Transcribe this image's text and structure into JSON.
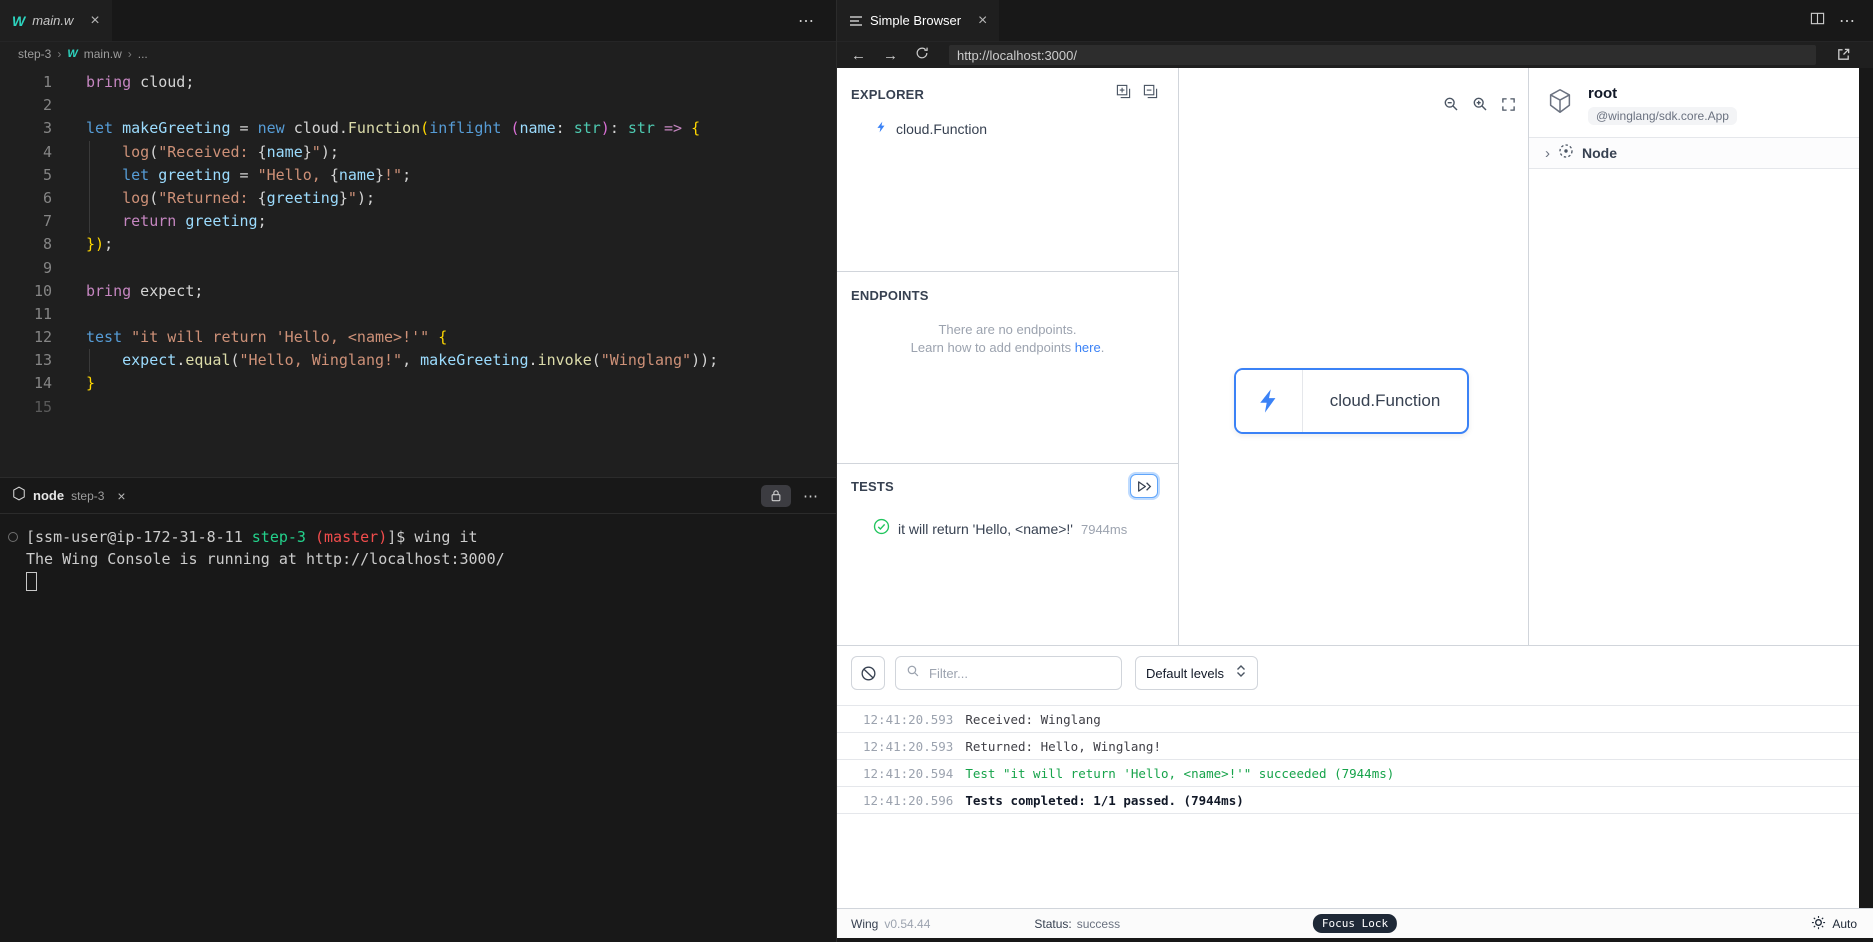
{
  "colors": {
    "accent": "#3b82f6",
    "wing_teal": "#2dd4bf",
    "success_green": "#16a34a",
    "terminal_green": "#23d18b",
    "terminal_red": "#f14c4c"
  },
  "editor": {
    "tab_label": "main.w",
    "breadcrumb": {
      "folder": "step-3",
      "file": "main.w",
      "more": "..."
    },
    "lines": [
      {
        "num": 1,
        "tokens": [
          [
            "p",
            "bring"
          ],
          [
            "d",
            " cloud;"
          ]
        ]
      },
      {
        "num": 2,
        "tokens": []
      },
      {
        "num": 3,
        "tokens": [
          [
            "b",
            "let"
          ],
          [
            "d",
            " "
          ],
          [
            "v",
            "makeGreeting"
          ],
          [
            "d",
            " = "
          ],
          [
            "b",
            "new"
          ],
          [
            "d",
            " cloud."
          ],
          [
            "f",
            "Function"
          ],
          [
            "y",
            "("
          ],
          [
            "b",
            "inflight"
          ],
          [
            "d",
            " "
          ],
          [
            "o",
            "("
          ],
          [
            "v",
            "name"
          ],
          [
            "d",
            ": "
          ],
          [
            "t",
            "str"
          ],
          [
            "o",
            ")"
          ],
          [
            "d",
            ": "
          ],
          [
            "t",
            "str"
          ],
          [
            "p",
            " => "
          ],
          [
            "y",
            "{"
          ]
        ]
      },
      {
        "num": 4,
        "guide": true,
        "tokens": [
          [
            "d",
            "    "
          ],
          [
            "s",
            "log"
          ],
          [
            "d",
            "("
          ],
          [
            "s",
            "\"Received: "
          ],
          [
            "d",
            "{"
          ],
          [
            "v",
            "name"
          ],
          [
            "d",
            "}"
          ],
          [
            "s",
            "\""
          ],
          [
            "d",
            ");"
          ]
        ]
      },
      {
        "num": 5,
        "guide": true,
        "tokens": [
          [
            "d",
            "    "
          ],
          [
            "b",
            "let"
          ],
          [
            "d",
            " "
          ],
          [
            "v",
            "greeting"
          ],
          [
            "d",
            " = "
          ],
          [
            "s",
            "\"Hello, "
          ],
          [
            "d",
            "{"
          ],
          [
            "v",
            "name"
          ],
          [
            "d",
            "}"
          ],
          [
            "s",
            "!\""
          ],
          [
            "d",
            ";"
          ]
        ]
      },
      {
        "num": 6,
        "guide": true,
        "tokens": [
          [
            "d",
            "    "
          ],
          [
            "s",
            "log"
          ],
          [
            "d",
            "("
          ],
          [
            "s",
            "\"Returned: "
          ],
          [
            "d",
            "{"
          ],
          [
            "v",
            "greeting"
          ],
          [
            "d",
            "}"
          ],
          [
            "s",
            "\""
          ],
          [
            "d",
            ");"
          ]
        ]
      },
      {
        "num": 7,
        "guide": true,
        "tokens": [
          [
            "d",
            "    "
          ],
          [
            "p",
            "return"
          ],
          [
            "d",
            " "
          ],
          [
            "v",
            "greeting"
          ],
          [
            "d",
            ";"
          ]
        ]
      },
      {
        "num": 8,
        "tokens": [
          [
            "y",
            "})"
          ],
          [
            "d",
            ";"
          ]
        ]
      },
      {
        "num": 9,
        "tokens": []
      },
      {
        "num": 10,
        "tokens": [
          [
            "p",
            "bring"
          ],
          [
            "d",
            " expect;"
          ]
        ]
      },
      {
        "num": 11,
        "tokens": []
      },
      {
        "num": 12,
        "tokens": [
          [
            "b",
            "test"
          ],
          [
            "d",
            " "
          ],
          [
            "s",
            "\"it will return 'Hello, <name>!'\""
          ],
          [
            "d",
            " "
          ],
          [
            "y",
            "{"
          ]
        ]
      },
      {
        "num": 13,
        "guide": true,
        "tokens": [
          [
            "d",
            "    "
          ],
          [
            "v",
            "expect"
          ],
          [
            "d",
            "."
          ],
          [
            "f",
            "equal"
          ],
          [
            "d",
            "("
          ],
          [
            "s",
            "\"Hello, Winglang!\""
          ],
          [
            "d",
            ", "
          ],
          [
            "v",
            "makeGreeting"
          ],
          [
            "d",
            "."
          ],
          [
            "f",
            "invoke"
          ],
          [
            "d",
            "("
          ],
          [
            "s",
            "\"Winglang\""
          ],
          [
            "d",
            "));"
          ]
        ]
      },
      {
        "num": 14,
        "tokens": [
          [
            "y",
            "}"
          ]
        ]
      },
      {
        "num": 15,
        "dim": true,
        "tokens": []
      }
    ]
  },
  "terminal": {
    "tab_name": "node",
    "tab_detail": "step-3",
    "lines": [
      {
        "decoration": true,
        "tokens": [
          [
            "w",
            "[ssm-user@ip-172-31-8-11 "
          ],
          [
            "g",
            "step-3"
          ],
          [
            "w",
            " "
          ],
          [
            "r",
            "(master)"
          ],
          [
            "w",
            "]$ wing it"
          ]
        ]
      },
      {
        "tokens": [
          [
            "w",
            "The Wing Console is running at http://localhost:3000/"
          ]
        ]
      },
      {
        "cursor": true,
        "tokens": []
      }
    ]
  },
  "browser": {
    "tab_label": "Simple Browser",
    "url": "http://localhost:3000/"
  },
  "console": {
    "explorer": {
      "title": "EXPLORER",
      "item_label": "cloud.Function"
    },
    "endpoints": {
      "title": "ENDPOINTS",
      "empty_line1": "There are no endpoints.",
      "empty_line2": "Learn how to add endpoints ",
      "empty_link": "here",
      "empty_period": "."
    },
    "tests": {
      "title": "TESTS",
      "item_label": "it will return 'Hello, <name>!'",
      "item_duration": "7944ms"
    },
    "canvas": {
      "node_label": "cloud.Function"
    },
    "inspector": {
      "root_title": "root",
      "root_badge": "@winglang/sdk.core.App",
      "node_label": "Node"
    },
    "logs": {
      "filter_placeholder": "Filter...",
      "levels_label": "Default levels",
      "entries": [
        {
          "time": "12:41:20.593",
          "message": "Received: Winglang",
          "style": "default"
        },
        {
          "time": "12:41:20.593",
          "message": "Returned: Hello, Winglang!",
          "style": "default"
        },
        {
          "time": "12:41:20.594",
          "message": "Test \"it will return 'Hello, <name>!'\" succeeded (7944ms)",
          "style": "success"
        },
        {
          "time": "12:41:20.596",
          "message": "Tests completed: 1/1 passed. (7944ms)",
          "style": "bold"
        }
      ]
    },
    "statusbar": {
      "app": "Wing",
      "version": "v0.54.44",
      "status_label": "Status:",
      "status_value": "success",
      "focus_lock": "Focus Lock",
      "theme_label": "Auto"
    }
  }
}
